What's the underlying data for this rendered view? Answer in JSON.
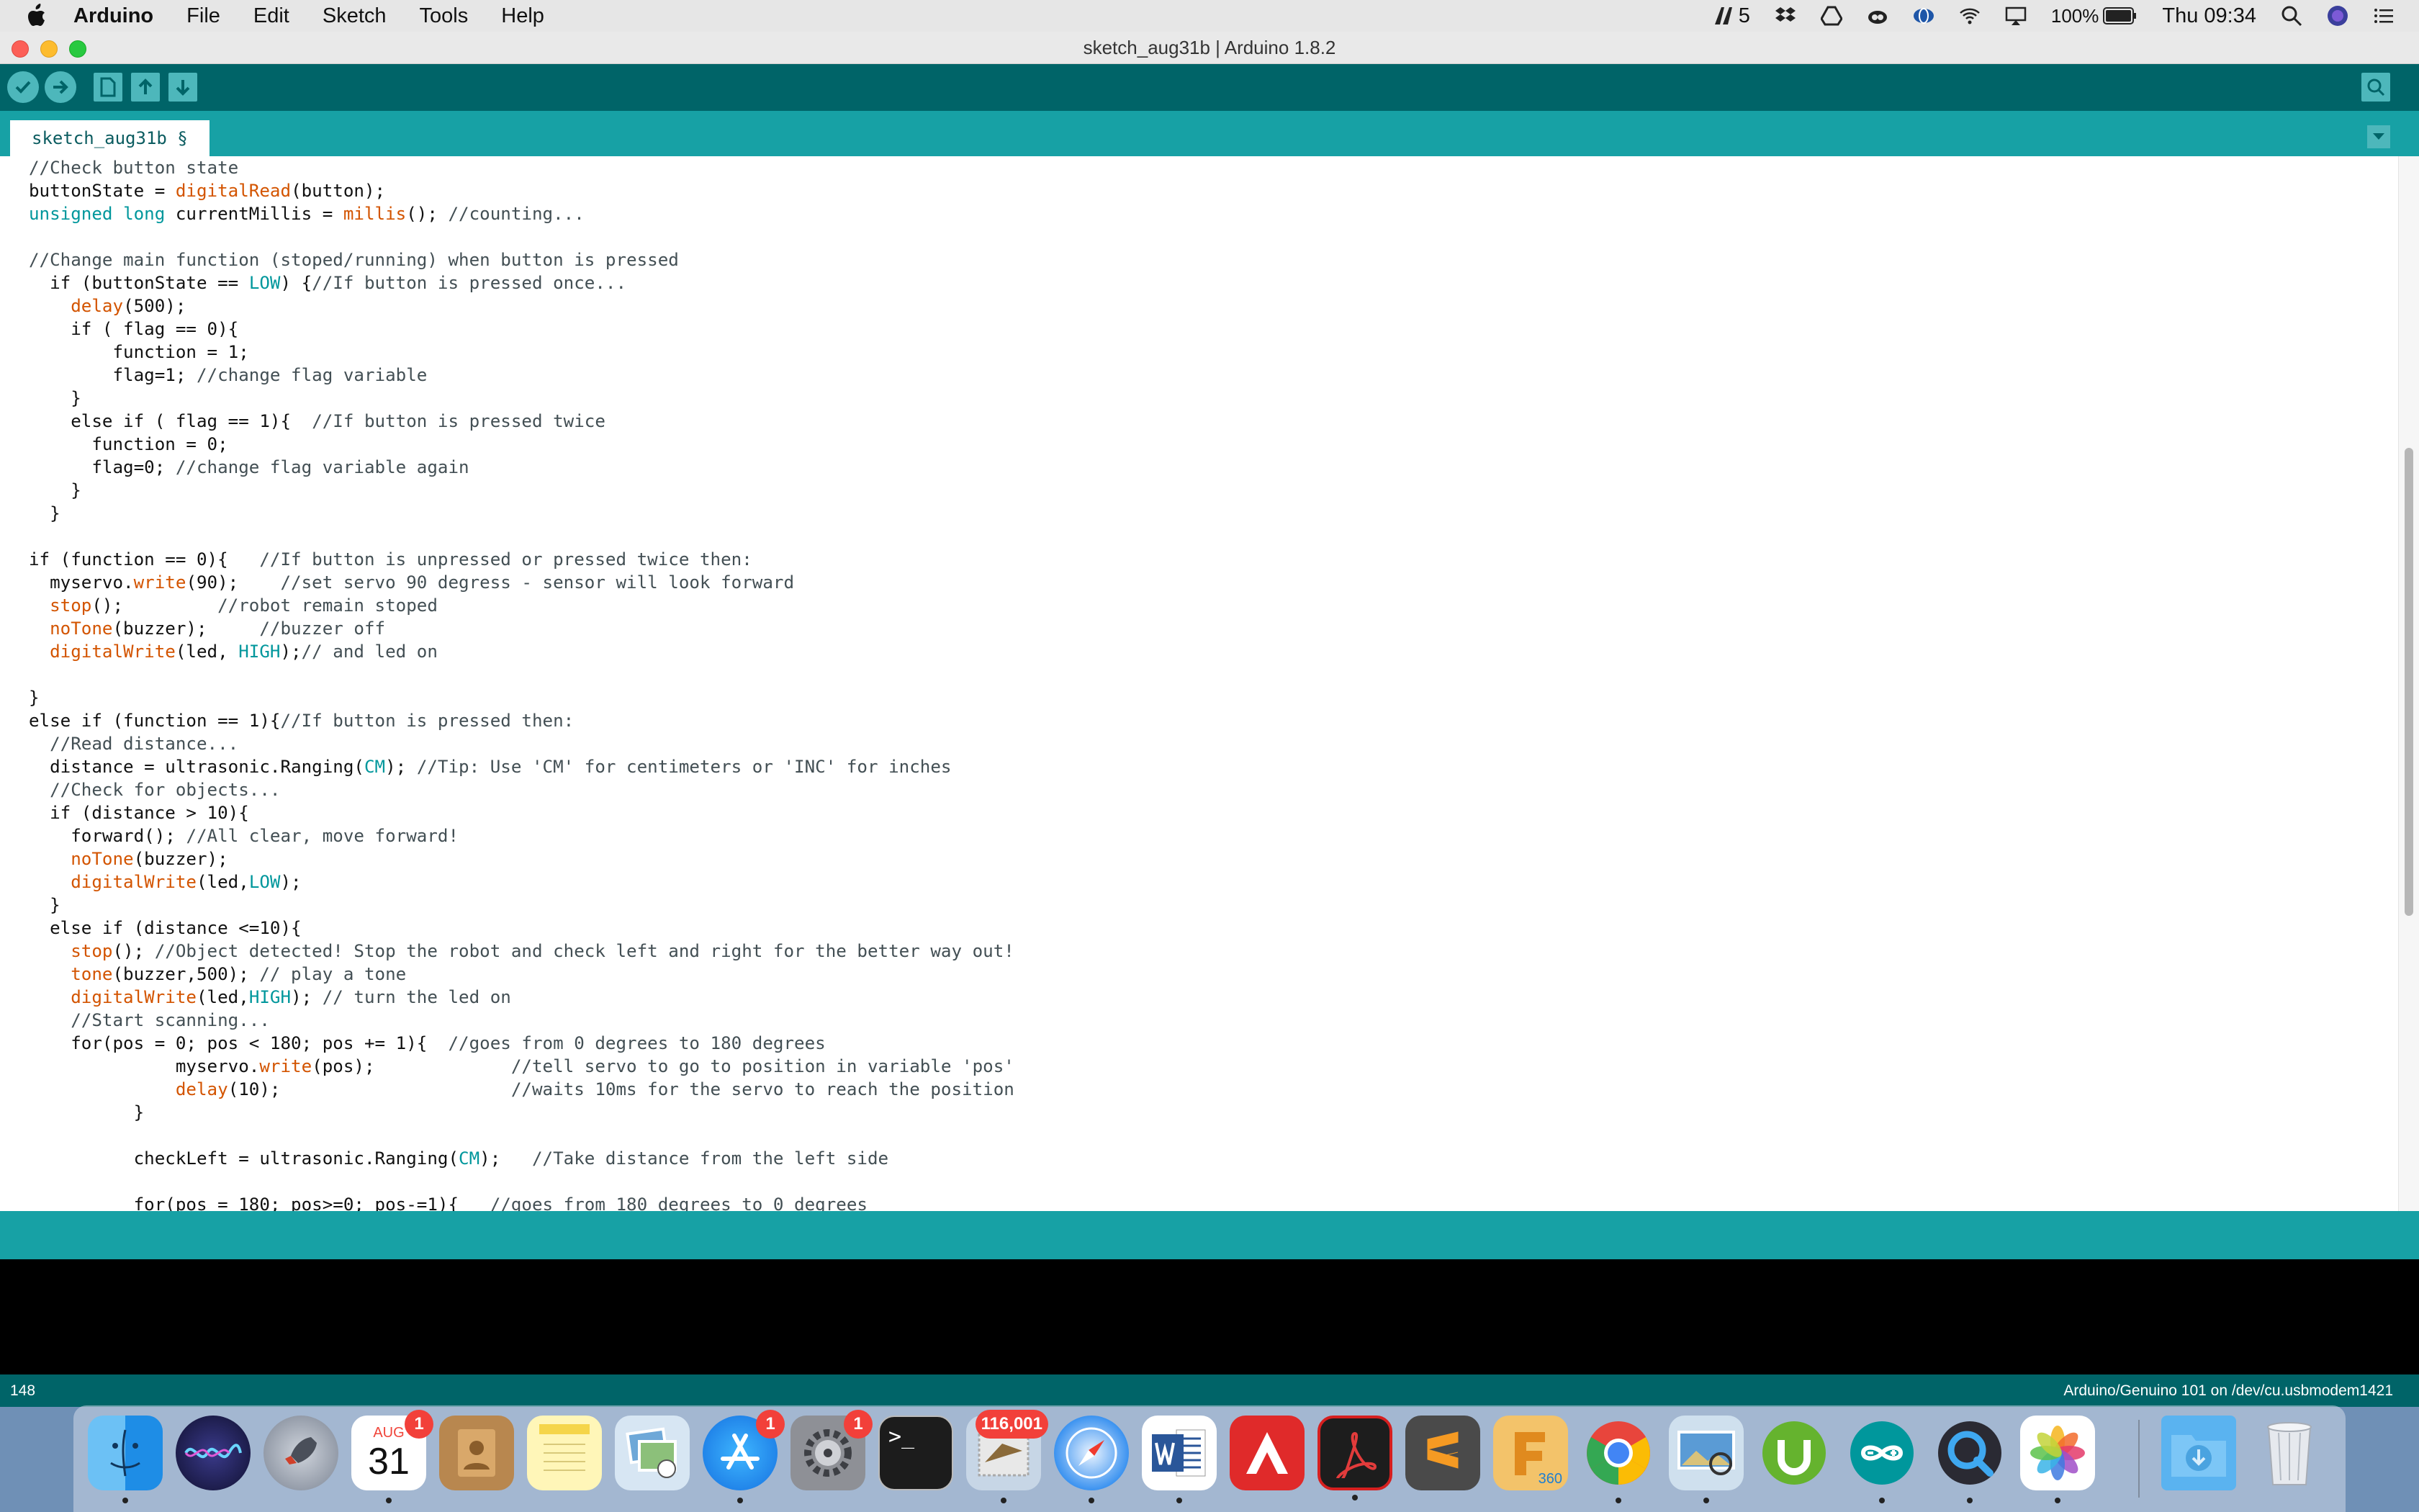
{
  "menubar": {
    "app_name": "Arduino",
    "items": [
      "File",
      "Edit",
      "Sketch",
      "Tools",
      "Help"
    ],
    "adobe_count": "5",
    "battery": "100%",
    "clock": "Thu 09:34"
  },
  "window": {
    "title": "sketch_aug31b | Arduino 1.8.2"
  },
  "toolbar": {
    "buttons": [
      "verify",
      "upload",
      "new",
      "open",
      "save",
      "serial-monitor"
    ]
  },
  "tabs": {
    "active": "sketch_aug31b §"
  },
  "editor": {
    "code": [
      "//Check button state",
      "buttonState = digitalRead(button);",
      "unsigned long currentMillis = millis(); //counting...",
      "",
      "//Change main function (stoped/running) when button is pressed",
      "  if (buttonState == LOW) {//If button is pressed once...",
      "    delay(500);",
      "    if ( flag == 0){",
      "        function = 1;",
      "        flag=1; //change flag variable",
      "    }",
      "    else if ( flag == 1){  //If button is pressed twice",
      "      function = 0;",
      "      flag=0; //change flag variable again",
      "    }",
      "  }",
      "",
      "if (function == 0){   //If button is unpressed or pressed twice then:",
      "  myservo.write(90);    //set servo 90 degress - sensor will look forward",
      "  stop();         //robot remain stoped",
      "  noTone(buzzer);     //buzzer off",
      "  digitalWrite(led, HIGH);// and led on",
      "",
      "}",
      "else if (function == 1){//If button is pressed then:",
      "  //Read distance...",
      "  distance = ultrasonic.Ranging(CM); //Tip: Use 'CM' for centimeters or 'INC' for inches",
      "  //Check for objects...",
      "  if (distance > 10){",
      "    forward(); //All clear, move forward!",
      "    noTone(buzzer);",
      "    digitalWrite(led,LOW);",
      "  }",
      "  else if (distance <=10){",
      "    stop(); //Object detected! Stop the robot and check left and right for the better way out!",
      "    tone(buzzer,500); // play a tone",
      "    digitalWrite(led,HIGH); // turn the led on",
      "    //Start scanning...",
      "    for(pos = 0; pos < 180; pos += 1){  //goes from 0 degrees to 180 degrees",
      "              myservo.write(pos);             //tell servo to go to position in variable 'pos'",
      "              delay(10);                      //waits 10ms for the servo to reach the position",
      "          }",
      "",
      "          checkLeft = ultrasonic.Ranging(CM);   //Take distance from the left side",
      "",
      "          for(pos = 180; pos>=0; pos-=1){   //goes from 180 degrees to 0 degrees"
    ]
  },
  "footer": {
    "line_number": "148",
    "board": "Arduino/Genuino 101 on /dev/cu.usbmodem1421"
  },
  "dock": {
    "calendar_month": "AUG",
    "calendar_day": "31",
    "calendar_badge": "1",
    "appstore_badge": "1",
    "prefs_badge": "1",
    "mail_badge": "116,001",
    "fusion_label": "360",
    "terminal_prompt": ">_"
  },
  "colors": {
    "toolbar": "#006468",
    "tabbar": "#17a1a5",
    "keyword": "#00979c",
    "function": "#d35400",
    "comment": "#434f54"
  }
}
